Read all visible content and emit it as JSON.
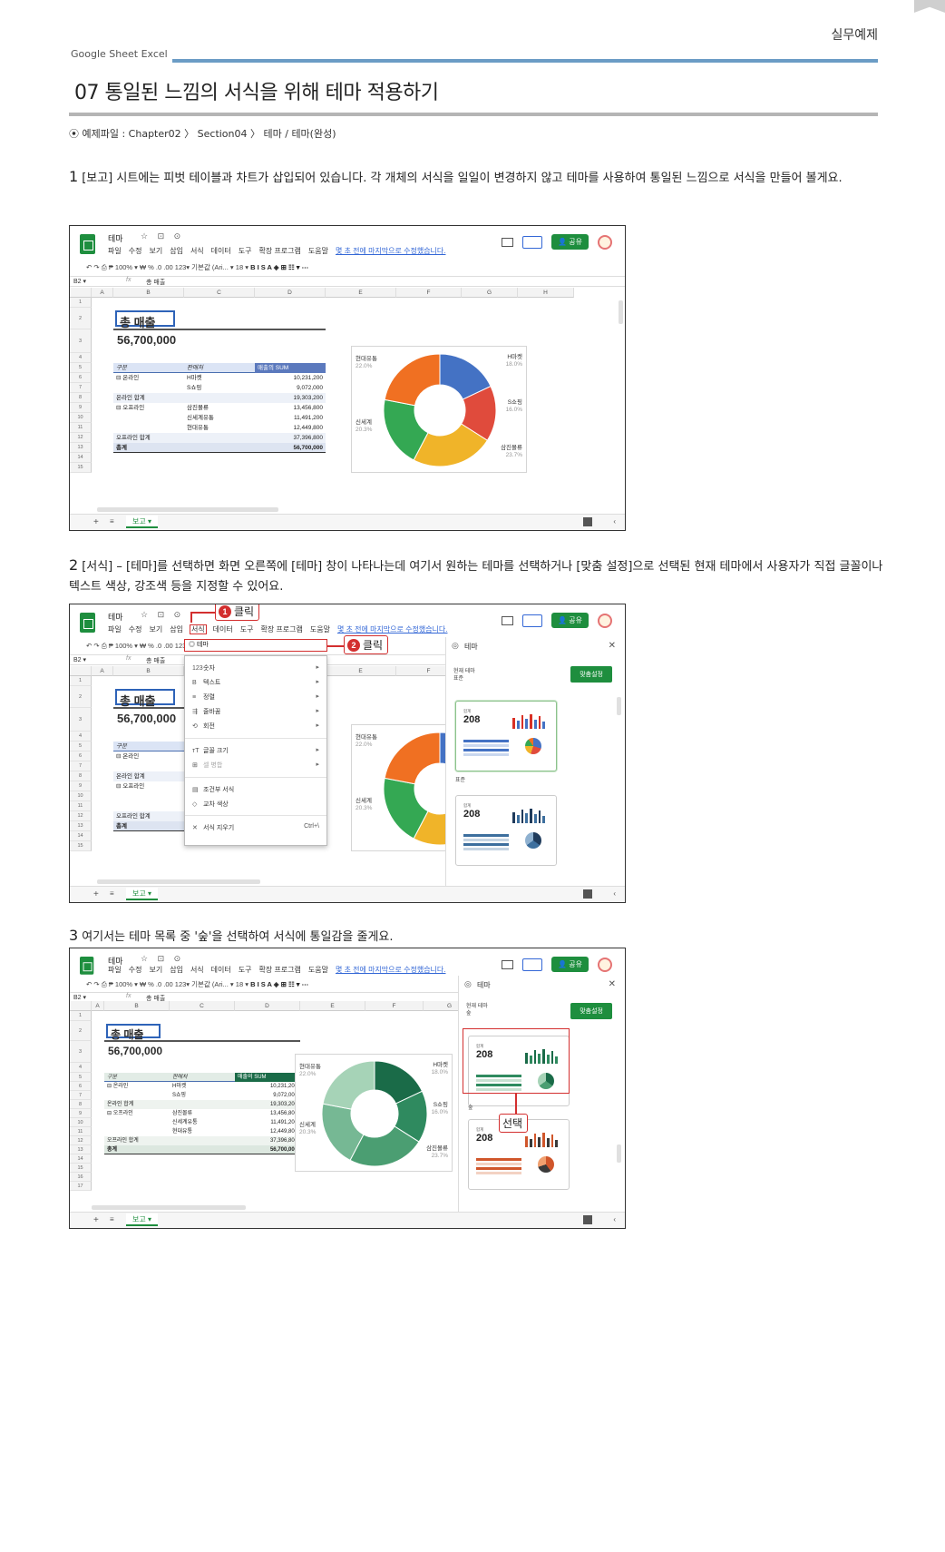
{
  "header": {
    "section": "실무예제",
    "brand": "Google Sheet  Excel",
    "title": "07 통일된 느낌의 서식을 위해 테마 적용하기",
    "source": "⦿ 예제파일 : Chapter02 〉 Section04 〉 테마 / 테마(완성)"
  },
  "steps": [
    {
      "num": "1",
      "text": "[보고] 시트에는 피벗 테이블과 차트가 삽입되어 있습니다. 각 개체의 서식을 일일이 변경하지 않고 테마를 사용하여 통일된 느낌으로 서식을 만들어 볼게요."
    },
    {
      "num": "2",
      "text": "[서식] – [테마]를 선택하면 화면 오른쪽에 [테마] 창이 나타나는데 여기서 원하는 테마를 선택하거나 [맞춤 설정]으로 선택된 현재 테마에서 사용자가 직접 글꼴이나 텍스트 색상, 강조색 등을 지정할 수 있어요."
    },
    {
      "num": "3",
      "text": "여기서는 테마 목록 중 '숲'을 선택하여 서식에 통일감을 줄게요."
    }
  ],
  "sheet": {
    "doc_title": "테마",
    "title_icons": "☆ ⊡ ⊙",
    "menus": [
      "파일",
      "수정",
      "보기",
      "삽입",
      "서식",
      "데이터",
      "도구",
      "확장 프로그램",
      "도움말"
    ],
    "saved": "몇 초 전에 마지막으로 수정했습니다.",
    "share": "공유",
    "toolbar": "↶  ↷  ⎙  ₱     100%  ▾   ₩   %   .0   .00   123▾    기본값 (Ari...  ▾    18    ▾",
    "toolbar_bold": "B  I  S  A    ◈  ⊞  ☷ ▾   ⋯",
    "cell_ref": "B2",
    "fx": "fx",
    "formula": "총 매출",
    "columns": [
      "A",
      "B",
      "C",
      "D",
      "E",
      "F",
      "G",
      "H"
    ],
    "total_label": "총 매출",
    "total_value": "56,700,000",
    "pivot_headers": [
      "구분",
      "판매처",
      "매출의 SUM"
    ],
    "pivot_rows": [
      [
        "⊟ 온라인",
        "H마켓",
        "10,231,200"
      ],
      [
        "",
        "S쇼핑",
        "9,072,000"
      ],
      [
        "온라인 합계",
        "",
        "19,303,200"
      ],
      [
        "⊟ 오프라인",
        "삼진몰류",
        "13,456,800"
      ],
      [
        "",
        "신세계유통",
        "11,491,200"
      ],
      [
        "",
        "현대유통",
        "12,449,800"
      ],
      [
        "오프라인 합계",
        "",
        "37,396,800"
      ],
      [
        "총계",
        "",
        "56,700,000"
      ]
    ],
    "sheet_tab": "보고 ▾",
    "add": "+",
    "list": "≡"
  },
  "chart_data": {
    "type": "pie",
    "categories": [
      "H마켓",
      "S쇼핑",
      "삼진몰류",
      "신세계",
      "현대유통"
    ],
    "values": [
      18.0,
      16.0,
      23.7,
      20.3,
      22.0
    ],
    "percent_labels": [
      "18.0%",
      "16.0%",
      "23.7%",
      "20.3%",
      "22.0%"
    ],
    "title": "",
    "donut": true,
    "colors_default": [
      "#4472c4",
      "#e04b3c",
      "#f0b429",
      "#34a853",
      "#f07022"
    ],
    "colors_forest": [
      "#1a6b48",
      "#2f8a5f",
      "#4b9e72",
      "#76b894",
      "#a6d3b7"
    ]
  },
  "format_menu": {
    "theme_item": "테마",
    "items": [
      {
        "icon": "123",
        "label": "숫자",
        "arrow": "▸"
      },
      {
        "icon": "B",
        "label": "텍스트",
        "arrow": "▸"
      },
      {
        "icon": "≡",
        "label": "정렬",
        "arrow": "▸"
      },
      {
        "icon": "⇶",
        "label": "줄바꿈",
        "arrow": "▸"
      },
      {
        "icon": "⟲",
        "label": "회전",
        "arrow": "▸"
      },
      {
        "icon": "тT",
        "label": "글꼴 크기",
        "arrow": "▸"
      },
      {
        "icon": "⊞",
        "label": "셀 병합",
        "arrow": "▸"
      },
      {
        "icon": "▤",
        "label": "조건부 서식",
        "arrow": ""
      },
      {
        "icon": "◇",
        "label": "교차 색상",
        "arrow": ""
      },
      {
        "icon": "✕",
        "label": "서식 지우기",
        "arrow": "Ctrl+\\"
      }
    ]
  },
  "callouts": {
    "click1": "클릭",
    "click1_num": "1",
    "click2": "클릭",
    "click2_num": "2",
    "select": "선택"
  },
  "theme_panel": {
    "title": "테마",
    "current_label": "현재 테마",
    "current_standard": "표준",
    "current_forest": "숲",
    "custom_button": "맞춤설정",
    "card_small": "합계",
    "card_value": "208",
    "theme_standard": "표준",
    "theme_forest": "숲"
  }
}
